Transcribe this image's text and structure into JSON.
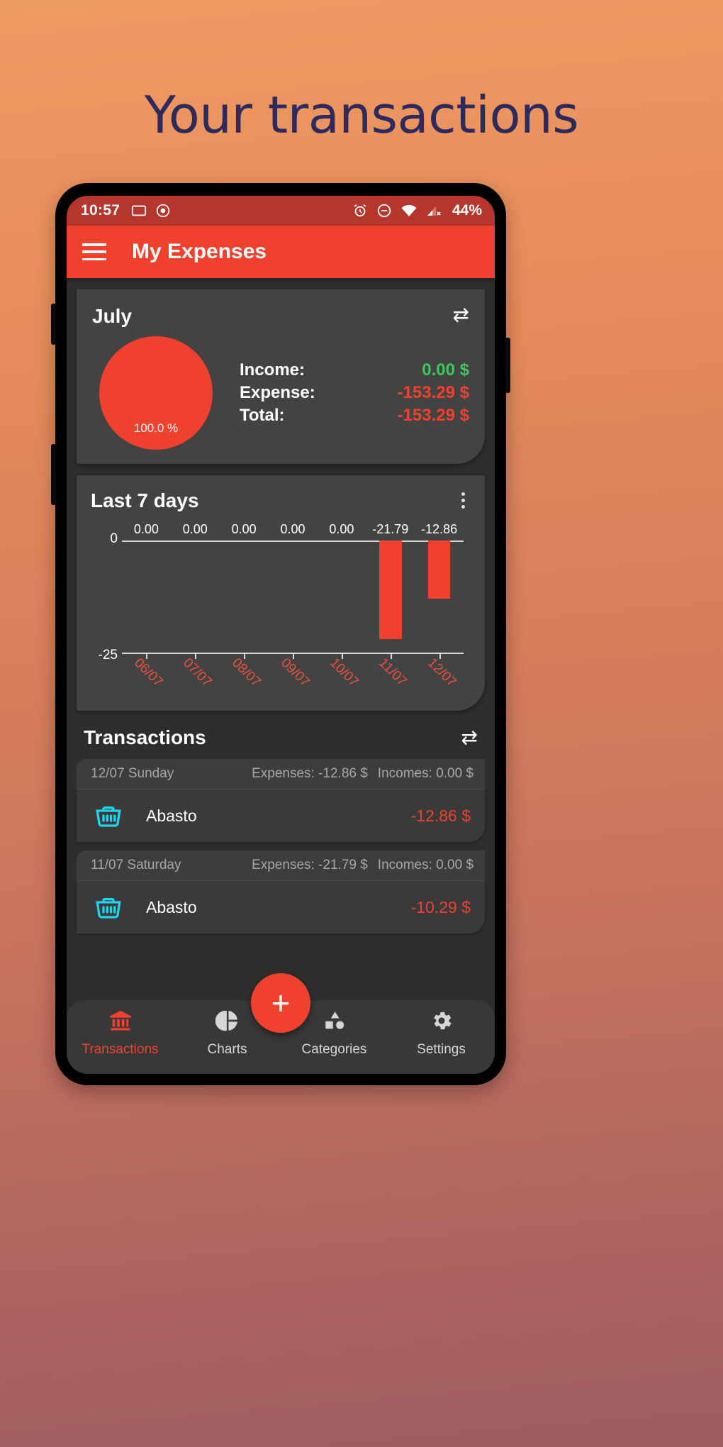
{
  "promo": {
    "headline": "Your transactions"
  },
  "status_bar": {
    "time": "10:57",
    "battery": "44%",
    "left_icons": [
      "cast-icon",
      "record-icon"
    ],
    "right_icons": [
      "alarm-icon",
      "do-not-disturb-icon",
      "wifi-icon",
      "cellular-off-icon"
    ],
    "background": "#b5362c"
  },
  "app_bar": {
    "title": "My Expenses",
    "menu_icon": "hamburger-menu-icon",
    "background": "#f0412f"
  },
  "summary_card": {
    "title": "July",
    "swap_icon": "⇄",
    "pie_percent": "100.0 %",
    "pie_color": "#f0412f",
    "rows": [
      {
        "label": "Income:",
        "value": "0.00 $",
        "color": "#3ec65a"
      },
      {
        "label": "Expense:",
        "value": "-153.29 $",
        "color": "#f0412f"
      },
      {
        "label": "Total:",
        "value": "-153.29 $",
        "color": "#f0412f"
      }
    ]
  },
  "chart_card": {
    "title": "Last 7 days",
    "menu_icon": "overflow-menu-icon"
  },
  "chart_data": {
    "type": "bar",
    "title": "Last 7 days",
    "categories": [
      "06/07",
      "07/07",
      "08/07",
      "09/07",
      "10/07",
      "11/07",
      "12/07"
    ],
    "values": [
      0.0,
      0.0,
      0.0,
      0.0,
      0.0,
      -21.79,
      -12.86
    ],
    "value_labels": [
      "0.00",
      "0.00",
      "0.00",
      "0.00",
      "0.00",
      "-21.79",
      "-12.86"
    ],
    "ylim": [
      -25,
      0
    ],
    "ytick_labels": [
      "0",
      "-25"
    ],
    "xlabel": "",
    "ylabel": "",
    "grid": false,
    "legend": "none",
    "bar_color": "#f0412f",
    "xtick_color": "#e8513c",
    "axis_color": "#d8d8d8"
  },
  "transactions": {
    "title": "Transactions",
    "swap_icon": "⇄",
    "groups": [
      {
        "date": "12/07 Sunday",
        "expenses_label": "Expenses: -12.86 $",
        "incomes_label": "Incomes: 0.00 $",
        "rows": [
          {
            "icon": "shopping-basket-icon",
            "name": "Abasto",
            "amount": "-12.86 $"
          }
        ]
      },
      {
        "date": "11/07 Saturday",
        "expenses_label": "Expenses: -21.79 $",
        "incomes_label": "Incomes: 0.00 $",
        "rows": [
          {
            "icon": "shopping-basket-icon",
            "name": "Abasto",
            "amount": "-10.29 $"
          }
        ]
      }
    ]
  },
  "bottom_nav": {
    "fab_label": "+",
    "items": [
      {
        "label": "Transactions",
        "icon": "bank-icon",
        "active": true
      },
      {
        "label": "Charts",
        "icon": "pie-chart-icon",
        "active": false
      },
      {
        "label": "Categories",
        "icon": "shapes-icon",
        "active": false
      },
      {
        "label": "Settings",
        "icon": "gear-icon",
        "active": false
      }
    ]
  }
}
